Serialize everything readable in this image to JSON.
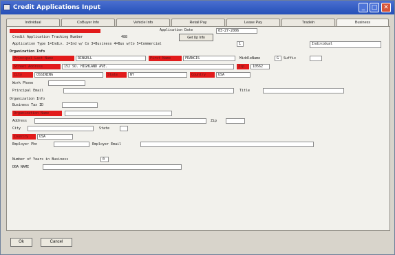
{
  "window": {
    "title": "Credit Applications Input",
    "minimize": "_",
    "maximize": "□",
    "close": "✕"
  },
  "tabs": [
    "Individual",
    "CoBuyer Info",
    "Vehicle Info",
    "Retail Pay",
    "Lease Pay",
    "Tradeln",
    "Business"
  ],
  "header": {
    "application_date_label": "Application Date",
    "application_date_value": "03-27-2006",
    "tracking_label": "Credit Application Tracking Number",
    "tracking_value": "488",
    "get_up_info": "Get Up Info",
    "app_type_label": "Application Type 1=Indiv. 2=Ind w/ Co 3=Business 4=Bus w/Co 5=Commercial",
    "app_type_value": "1",
    "app_type_desc": "Individual"
  },
  "org": {
    "section": "Organization Info",
    "last_name_label": "Principal Last Name",
    "last_name_value": "RINGELL",
    "first_name_label": "First Name",
    "first_name_value": "FRANCIS",
    "middle_name_label": "MiddleName",
    "middle_name_value": "G",
    "suffix_label": "Suffix",
    "street_label": "Street Address",
    "street_value": "152 SO. HIGHLAND AVE.",
    "zip_label": "Zip",
    "zip_value": "10562",
    "city_label": "City",
    "city_value": "OSSINING",
    "state_label": "State",
    "state_value": "NY",
    "country_label": "Country",
    "country_value": "USA",
    "work_phone_label": "Work Phone",
    "principal_email_label": "Principal Email",
    "title_label": "Title"
  },
  "orginfo": {
    "section": "Organization Info",
    "tax_id_label": "Business Tax ID",
    "org_name_label": "Organization Name",
    "address_label": "Address",
    "zip_label": "Zip",
    "city_label": "City",
    "state_label": "State",
    "country_label": "Country",
    "country_value": "USA",
    "employer_phone_label": "Employer Phn",
    "employer_email_label": "Employer Email",
    "years_label": "Number of Years in Business",
    "years_value": "0",
    "dba_label": "DBA NAME"
  },
  "footer": {
    "ok": "Ok",
    "cancel": "Cancel"
  },
  "colors": {
    "titlebar": "#2550b8",
    "required": "#e21b1b",
    "panel": "#f2f1ec"
  },
  "icons": [
    "app-window-icon",
    "minimize-icon",
    "maximize-icon",
    "close-icon"
  ]
}
